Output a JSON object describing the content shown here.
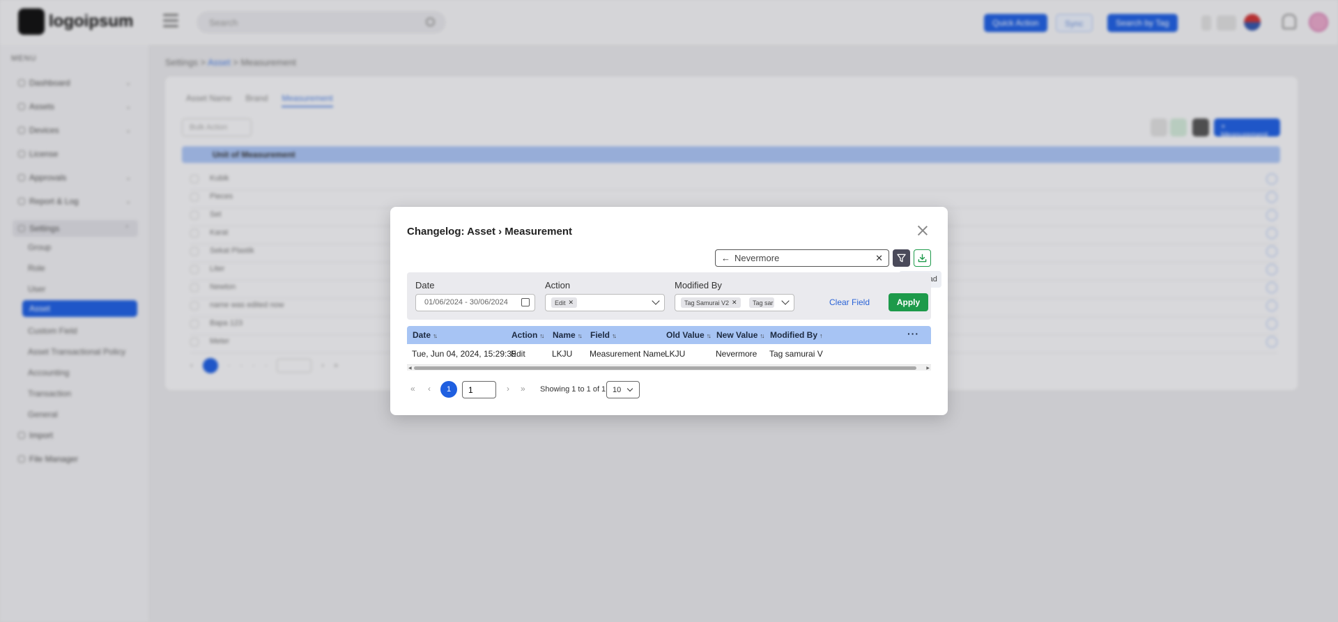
{
  "app": {
    "logo_text": "logoipsum",
    "search_placeholder": "Search",
    "top_buttons": [
      "Quick Action",
      "Sync",
      "Search by Tag"
    ],
    "menu_title": "MENU",
    "sidebar_items": [
      "Dashboard",
      "Assets",
      "Devices",
      "License",
      "Approvals",
      "Report & Log",
      "Settings"
    ],
    "settings_sub": [
      "Group",
      "Role",
      "User",
      "Asset",
      "Custom Field",
      "Asset Transactional Policy",
      "Accounting",
      "Transaction",
      "General"
    ],
    "sidebar_bottom": [
      "Import",
      "File Manager"
    ],
    "active_sub": "Asset",
    "breadcrumb": [
      "Settings",
      "Asset",
      "Measurement"
    ],
    "tabs": [
      "Asset Name",
      "Brand",
      "Measurement"
    ],
    "bulk_action": "Bulk Action",
    "add_button": "+ Measurement",
    "table_header": "Unit of Measurement",
    "table_rows": [
      "Kubik",
      "Pieces",
      "Set",
      "Karat",
      "Sekat Plastik",
      "Liter",
      "Newton",
      "name was edited now",
      "Bapa 123",
      "Meter"
    ]
  },
  "modal": {
    "title": "Changelog: Asset › Measurement",
    "search_value": "Nevermore",
    "download_tooltip": "Download",
    "filters": {
      "date_label": "Date",
      "date_value": "01/06/2024 - 30/06/2024",
      "action_label": "Action",
      "action_chips": [
        "Edit"
      ],
      "modified_by_label": "Modified By",
      "modified_by_chips": [
        "Tag Samurai V2",
        "Tag sar"
      ],
      "clear_label": "Clear Field",
      "apply_label": "Apply"
    },
    "columns": [
      "Date",
      "Action",
      "Name",
      "Field",
      "Old Value",
      "New Value",
      "Modified By"
    ],
    "rows": [
      [
        "Tue, Jun 04, 2024, 15:29:39",
        "Edit",
        "LKJU",
        "Measurement Name",
        "LKJU",
        "Nevermore",
        "Tag samurai V"
      ]
    ],
    "pagination": {
      "current_page": "1",
      "page_input": "1",
      "info": "Showing 1 to 1 of 1",
      "page_size": "10"
    }
  },
  "colors": {
    "primary": "#1f5fe0",
    "header_blue": "#a7c4f4",
    "apply_green": "#1d9a4a",
    "filter_dark": "#4a4a5a"
  },
  "icons": [
    "search-icon",
    "menu-icon",
    "close-icon",
    "arrow-left-icon",
    "clear-icon",
    "filter-icon",
    "download-icon",
    "calendar-icon",
    "chevron-down-icon",
    "sort-icon",
    "more-icon",
    "first-page-icon",
    "prev-page-icon",
    "next-page-icon",
    "last-page-icon"
  ]
}
